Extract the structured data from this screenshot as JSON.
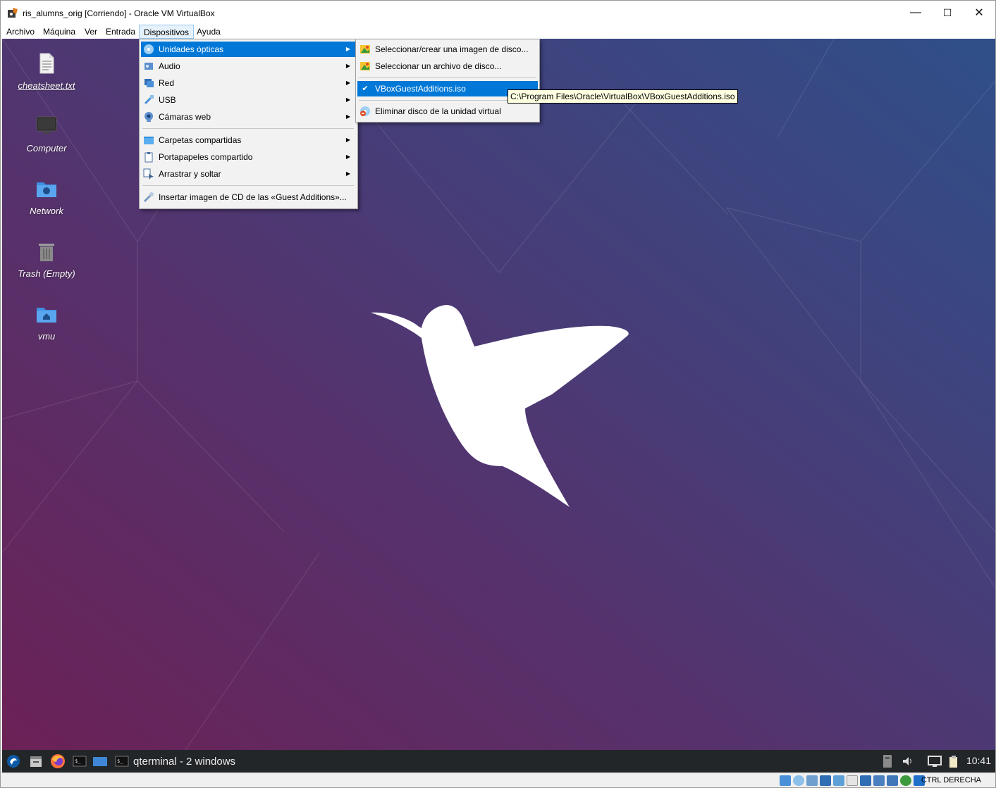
{
  "window": {
    "title": "ris_alumns_orig [Corriendo] - Oracle VM VirtualBox",
    "minimize": "—",
    "maximize": "☐",
    "close": "✕"
  },
  "menubar": {
    "items": [
      "Archivo",
      "Máquina",
      "Ver",
      "Entrada",
      "Dispositivos",
      "Ayuda"
    ],
    "active": "Dispositivos"
  },
  "devices_menu": {
    "items": [
      {
        "label": "Unidades ópticas",
        "icon": "optical-disc-icon",
        "submenu": true,
        "highlighted": true
      },
      {
        "label": "Audio",
        "icon": "audio-icon",
        "submenu": true
      },
      {
        "label": "Red",
        "icon": "network-icon",
        "submenu": true
      },
      {
        "label": "USB",
        "icon": "usb-icon",
        "submenu": true
      },
      {
        "label": "Cámaras web",
        "icon": "webcam-icon",
        "submenu": true
      },
      {
        "label": "Carpetas compartidas",
        "icon": "shared-folder-icon",
        "submenu": true
      },
      {
        "label": "Portapapeles compartido",
        "icon": "clipboard-icon",
        "submenu": true
      },
      {
        "label": "Arrastrar y soltar",
        "icon": "drag-drop-icon",
        "submenu": true
      },
      {
        "label": "Insertar imagen de CD de las «Guest Additions»...",
        "icon": "guest-additions-icon",
        "submenu": false
      }
    ]
  },
  "optical_submenu": {
    "items": [
      {
        "label": "Seleccionar/crear una imagen de disco...",
        "icon": "disk-image-icon"
      },
      {
        "label": "Seleccionar un archivo de disco...",
        "icon": "disk-file-icon"
      },
      {
        "label": "VBoxGuestAdditions.iso",
        "icon": "check-icon",
        "checked": true,
        "highlighted": true
      },
      {
        "label": "Eliminar disco de la unidad virtual",
        "icon": "eject-disc-icon"
      }
    ]
  },
  "tooltip": "C:\\Program Files\\Oracle\\VirtualBox\\VBoxGuestAdditions.iso",
  "desktop_icons": [
    {
      "label": "cheatsheet.txt",
      "icon": "text-file-icon"
    },
    {
      "label": "Computer",
      "icon": "computer-icon"
    },
    {
      "label": "Network",
      "icon": "network-folder-icon"
    },
    {
      "label": "Trash (Empty)",
      "icon": "trash-icon"
    },
    {
      "label": "vmu",
      "icon": "home-folder-icon"
    }
  ],
  "taskbar": {
    "task_label": "qterminal - 2 windows",
    "clock": "10:41"
  },
  "statusbar": {
    "host_key": "CTRL DERECHA"
  },
  "colors": {
    "menu_highlight": "#0078d7",
    "taskbar": "#232629",
    "desktop_gradient_start": "#6b2156",
    "desktop_gradient_end": "#2f4f89"
  }
}
